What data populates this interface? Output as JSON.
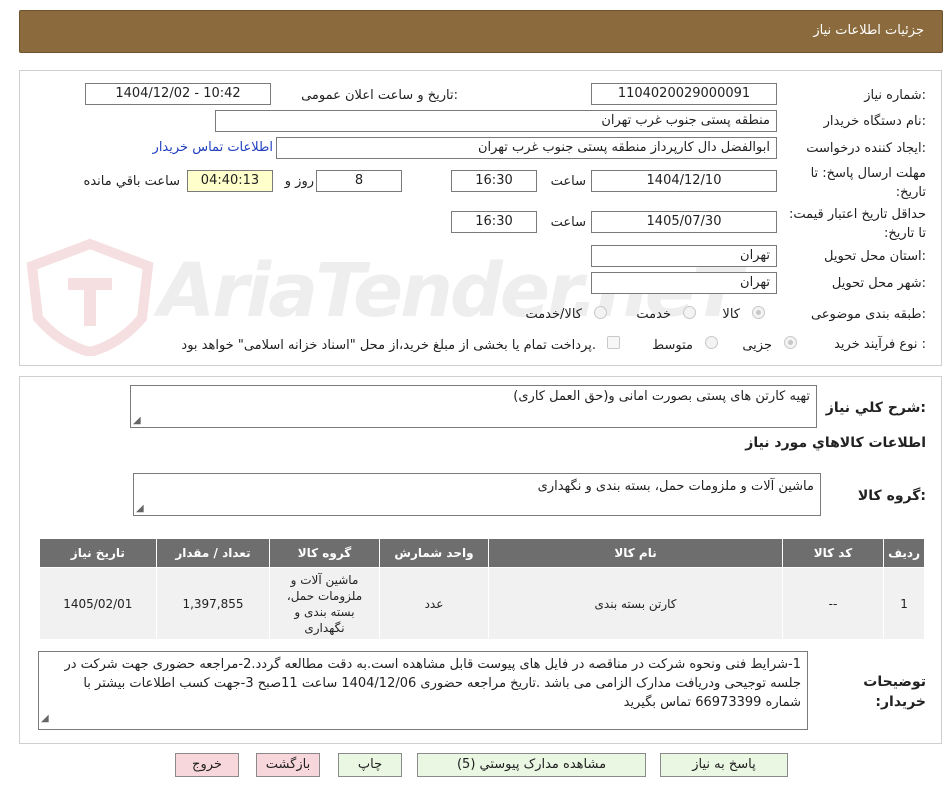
{
  "header": {
    "title": "جزئیات اطلاعات نیاز"
  },
  "form": {
    "need_number_label": "شماره نیاز:",
    "need_number": "1104020029000091",
    "announce_label": "تاریخ و ساعت اعلان عمومی:",
    "announce_value": "1404/12/02 - 10:42",
    "buyer_org_label": "نام دستگاه خریدار:",
    "buyer_org": "منطقه پستی جنوب غرب تهران",
    "requester_label": "ایجاد کننده درخواست:",
    "requester": "ابوالفضل  دال  کارپرداز منطقه پستی جنوب غرب تهران",
    "contact_link": "اطلاعات تماس خریدار",
    "deadline_label": "مهلت ارسال پاسخ: تا تاریخ:",
    "deadline_date": "1404/12/10",
    "time_label": "ساعت",
    "deadline_time": "16:30",
    "days_value": "8",
    "days_label": "روز و",
    "remaining_time": "04:40:13",
    "remaining_label": "ساعت باقي مانده",
    "validity_label": "حداقل تاريخ اعتبار قيمت: تا تاريخ:",
    "validity_date": "1405/07/30",
    "validity_time": "16:30",
    "province_label": "استان محل تحویل:",
    "province": "تهران",
    "city_label": "شهر محل تحویل:",
    "city": "تهران",
    "category_label": "طبقه بندی موضوعی:",
    "category_options": [
      "کالا",
      "خدمت",
      "کالا/خدمت"
    ],
    "process_label": "نوع فرآیند خرید :",
    "process_options": [
      "جزیی",
      "متوسط"
    ],
    "payment_note": "پرداخت تمام یا بخشی از مبلغ خرید،از محل \"اسناد خزانه اسلامی\" خواهد بود."
  },
  "details": {
    "summary_label": "شرح کلي نياز:",
    "summary": "تهیه کارتن های پستی بصورت امانی و(حق العمل کاری)",
    "goods_info_title": "اطلاعات کالاهاي مورد نياز",
    "goods_group_label": "گروه کالا:",
    "goods_group": "ماشین آلات و ملزومات حمل، بسته بندی و نگهداری",
    "table": {
      "headers": [
        "ردیف",
        "کد کالا",
        "نام کالا",
        "واحد شمارش",
        "گروه کالا",
        "تعداد / مقدار",
        "تاریخ نیاز"
      ],
      "rows": [
        [
          "1",
          "--",
          "کارتن بسته بندی",
          "عدد",
          "ماشین آلات و ملزومات حمل، بسته بندی و نگهداری",
          "1,397,855",
          "1405/02/01"
        ]
      ]
    },
    "buyer_notes_label": "توضیحات خریدار:",
    "buyer_notes": "1-شرایط فنی ونحوه شرکت در مناقصه در فایل های پیوست قابل مشاهده است.به دقت مطالعه گردد.2-مراجعه حضوری جهت شرکت در جلسه توجیحی ودریافت مدارک الزامی می باشد .تاریخ مراجعه حضوری 1404/12/06 ساعت 11صبح 3-جهت کسب اطلاعات بیشتر با شماره 66973399 تماس بگیرید"
  },
  "buttons": {
    "reply": "پاسخ به نیاز",
    "attachments": "مشاهده مدارک پیوستي (5)",
    "print": "چاپ",
    "back": "بازگشت",
    "exit": "خروج"
  },
  "watermark": {
    "text": "AriaTender.neT"
  },
  "colors": {
    "header_bg": "#8b6b3d",
    "table_header_bg": "#6e6e6e",
    "remaining_bg": "#ffffcc",
    "link": "#1f3fbf"
  }
}
